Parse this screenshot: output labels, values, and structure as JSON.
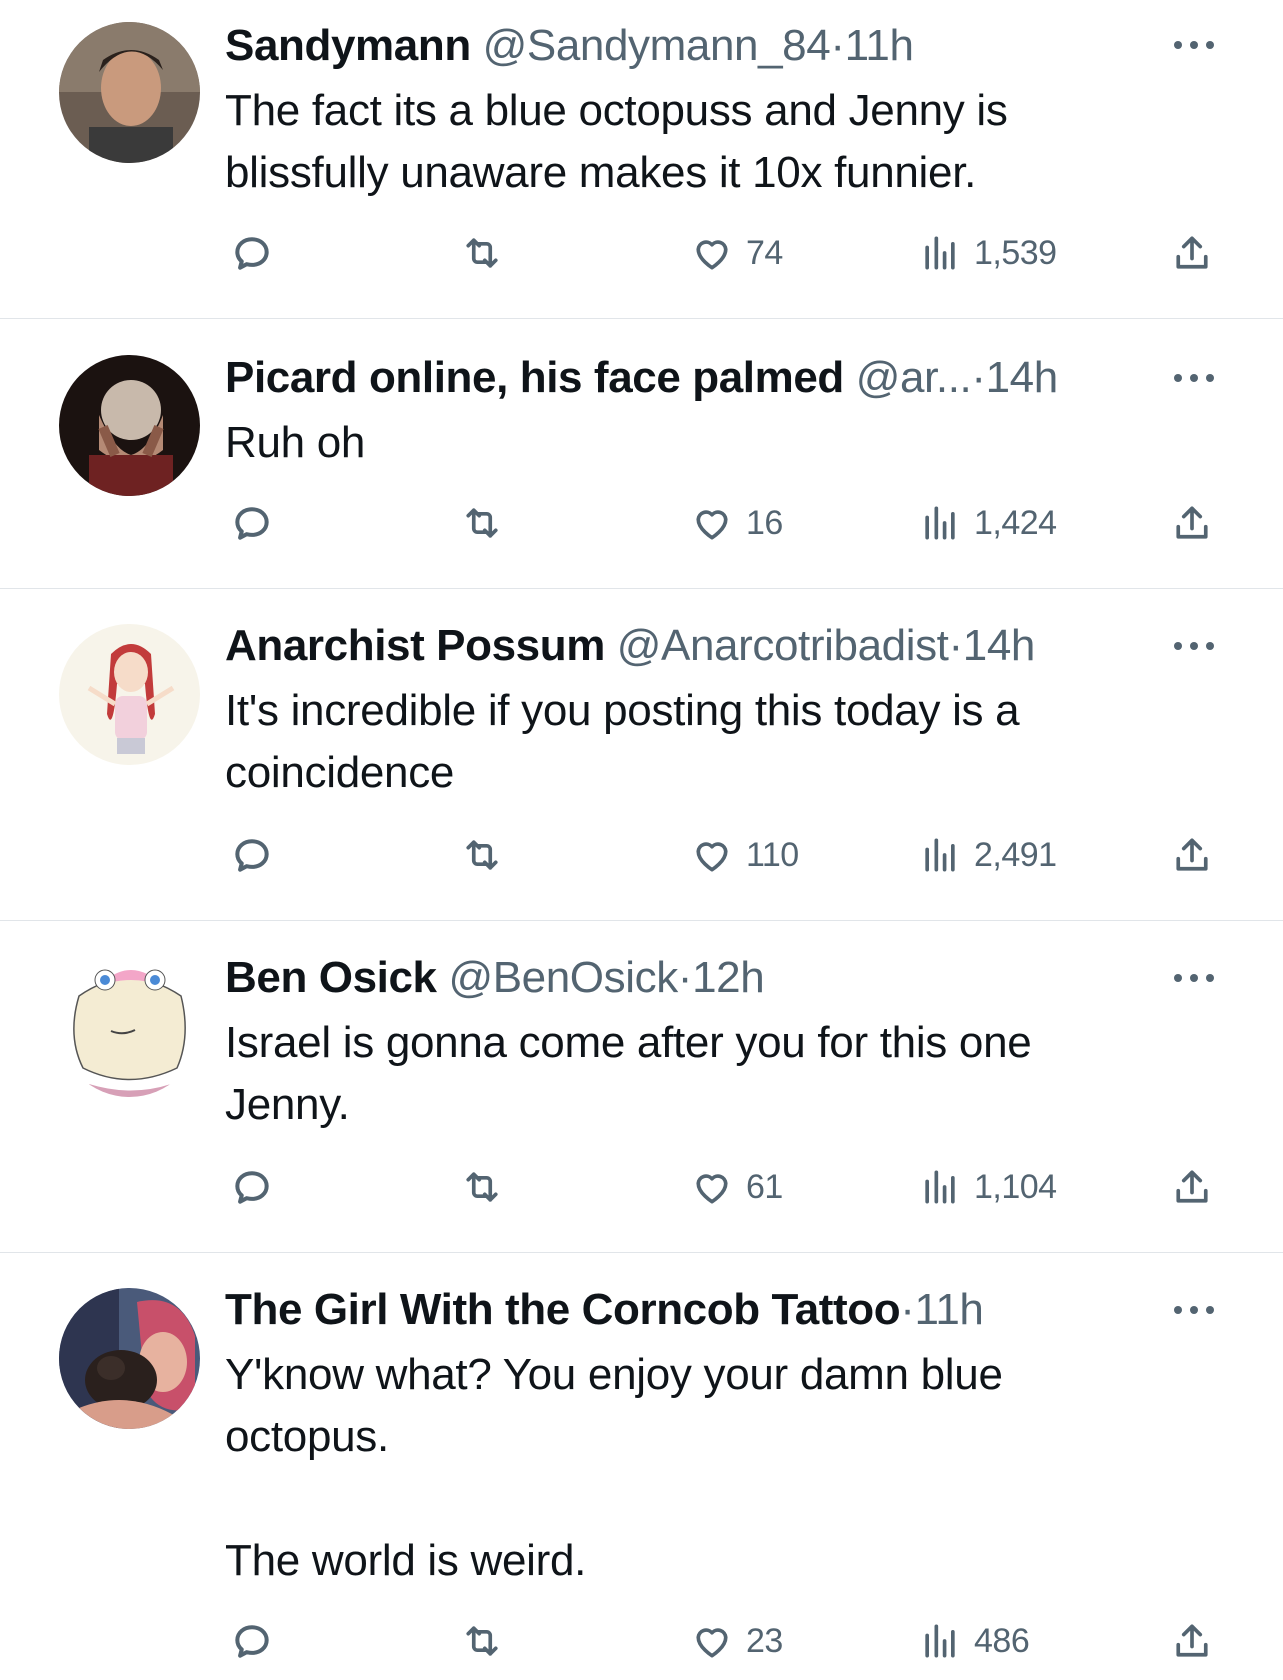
{
  "tweets": [
    {
      "name": "Sandymann",
      "handle": "@Sandymann_84",
      "time": "11h",
      "text": "The fact its a blue octopuss and Jenny is\nblissfully unaware makes it 10x funnier.",
      "likes": "74",
      "views": "1,539"
    },
    {
      "name": "Picard online, his face palmed",
      "handle": "@ar...",
      "time": "14h",
      "text": "Ruh oh",
      "likes": "16",
      "views": "1,424"
    },
    {
      "name": "Anarchist Possum",
      "handle": "@Anarcotribadist",
      "time": "14h",
      "text": "It's incredible if you posting this today is a\ncoincidence",
      "likes": "110",
      "views": "2,491"
    },
    {
      "name": "Ben Osick",
      "handle": "@BenOsick",
      "time": "12h",
      "text": "Israel is gonna come after you for this one\nJenny.",
      "likes": "61",
      "views": "1,104"
    },
    {
      "name": "The Girl With the Corncob Tattoo",
      "handle": "",
      "time": "11h",
      "text": "Y'know what?  You enjoy your damn blue\noctopus.\n\nThe world is weird.",
      "likes": "23",
      "views": "486"
    }
  ],
  "separator": "·",
  "icons": {
    "reply": "speech-bubble-icon",
    "retweet": "retweet-arrows-icon",
    "like": "heart-icon",
    "views": "bar-chart-icon",
    "share": "upload-arrow-icon",
    "more": "ellipsis-icon"
  },
  "colors": {
    "text": "#0f1419",
    "secondary": "#536471",
    "divider": "#e1e5e9"
  }
}
